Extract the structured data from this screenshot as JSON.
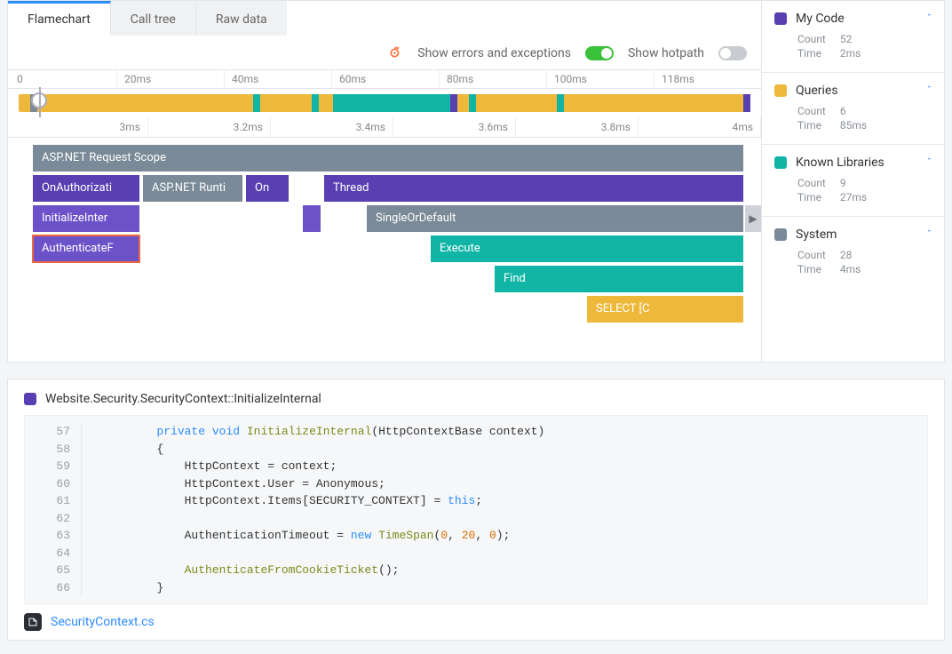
{
  "tabs": {
    "flamechart": "Flamechart",
    "calltree": "Call tree",
    "rawdata": "Raw data"
  },
  "options": {
    "errors": "Show errors and exceptions",
    "hotpath": "Show hotpath"
  },
  "overview_ruler": [
    "0",
    "20ms",
    "40ms",
    "60ms",
    "80ms",
    "100ms",
    "118ms"
  ],
  "detail_ruler": [
    "3ms",
    "3.2ms",
    "3.4ms",
    "3.6ms",
    "3.8ms",
    "4ms"
  ],
  "flame": {
    "r0": {
      "scope": "ASP.NET Request Scope"
    },
    "r1": {
      "onauth": "OnAuthorizati",
      "runtime": "ASP.NET Runti",
      "on": "On",
      "thread": "Thread"
    },
    "r2": {
      "init": "InitializeInter",
      "single": "SingleOrDefault"
    },
    "r3": {
      "auth": "AuthenticateF",
      "exec": "Execute"
    },
    "r4": {
      "find": "Find"
    },
    "r5": {
      "select": "SELECT   [C"
    }
  },
  "legend": {
    "mycode": {
      "title": "My Code",
      "color": "#5940b2",
      "count": "52",
      "time": "2ms"
    },
    "queries": {
      "title": "Queries",
      "color": "#eeb83a",
      "count": "6",
      "time": "85ms"
    },
    "known": {
      "title": "Known Libraries",
      "color": "#11b5a6",
      "count": "9",
      "time": "27ms"
    },
    "system": {
      "title": "System",
      "color": "#7a8a98",
      "count": "28",
      "time": "4ms"
    },
    "labels": {
      "count": "Count",
      "time": "Time"
    }
  },
  "code": {
    "title": "Website.Security.SecurityContext::InitializeInternal",
    "file": "SecurityContext.cs",
    "lines": [
      {
        "n": "57",
        "t": "        private void InitializeInternal(HttpContextBase context)"
      },
      {
        "n": "58",
        "t": "        {"
      },
      {
        "n": "59",
        "t": "            HttpContext = context;"
      },
      {
        "n": "60",
        "t": "            HttpContext.User = Anonymous;"
      },
      {
        "n": "61",
        "t": "            HttpContext.Items[SECURITY_CONTEXT] = this;"
      },
      {
        "n": "62",
        "t": ""
      },
      {
        "n": "63",
        "t": "            AuthenticationTimeout = new TimeSpan(0, 20, 0);"
      },
      {
        "n": "64",
        "t": ""
      },
      {
        "n": "65",
        "t": "            AuthenticateFromCookieTicket();"
      },
      {
        "n": "66",
        "t": "        }"
      }
    ]
  },
  "chart_data": {
    "type": "flamegraph",
    "overview": {
      "unit": "ms",
      "range": [
        0,
        118
      ],
      "segments": [
        {
          "category": "queries",
          "start": 0,
          "end": 2
        },
        {
          "category": "system",
          "start": 2,
          "end": 3
        },
        {
          "category": "queries",
          "start": 3,
          "end": 38
        },
        {
          "category": "known",
          "start": 38,
          "end": 39
        },
        {
          "category": "queries",
          "start": 39,
          "end": 48
        },
        {
          "category": "known",
          "start": 48,
          "end": 49
        },
        {
          "category": "queries",
          "start": 49,
          "end": 51
        },
        {
          "category": "known",
          "start": 51,
          "end": 70
        },
        {
          "category": "mycode",
          "start": 70,
          "end": 71
        },
        {
          "category": "queries",
          "start": 71,
          "end": 73
        },
        {
          "category": "known",
          "start": 73,
          "end": 74
        },
        {
          "category": "queries",
          "start": 74,
          "end": 87
        },
        {
          "category": "known",
          "start": 87,
          "end": 88
        },
        {
          "category": "queries",
          "start": 88,
          "end": 118
        }
      ],
      "viewport_marker_at": 3
    },
    "detail": {
      "unit": "ms",
      "xrange": [
        2.8,
        4.2
      ],
      "rows": [
        [
          {
            "name": "ASP.NET Request Scope",
            "category": "system",
            "start": 2.8,
            "end": 4.2
          }
        ],
        [
          {
            "name": "OnAuthorization",
            "category": "mycode",
            "start": 2.8,
            "end": 3.02
          },
          {
            "name": "ASP.NET Runtime",
            "category": "system",
            "start": 3.02,
            "end": 3.22
          },
          {
            "name": "On",
            "category": "mycode",
            "start": 3.22,
            "end": 3.3
          },
          {
            "name": "Thread",
            "category": "mycode",
            "start": 3.37,
            "end": 4.2
          }
        ],
        [
          {
            "name": "InitializeInternal",
            "category": "mycode",
            "start": 2.8,
            "end": 3.0,
            "selected_context": true
          },
          {
            "name": "",
            "category": "mycode",
            "start": 3.33,
            "end": 3.35
          },
          {
            "name": "SingleOrDefault",
            "category": "system",
            "start": 3.46,
            "end": 4.2
          }
        ],
        [
          {
            "name": "AuthenticateFromCookieTicket",
            "category": "mycode",
            "start": 2.8,
            "end": 3.0,
            "selected": true
          },
          {
            "name": "Execute",
            "category": "known",
            "start": 3.58,
            "end": 4.2
          }
        ],
        [
          {
            "name": "Find",
            "category": "known",
            "start": 3.7,
            "end": 4.2
          }
        ],
        [
          {
            "name": "SELECT [Cols…]",
            "category": "queries",
            "start": 3.88,
            "end": 4.2
          }
        ]
      ]
    }
  }
}
